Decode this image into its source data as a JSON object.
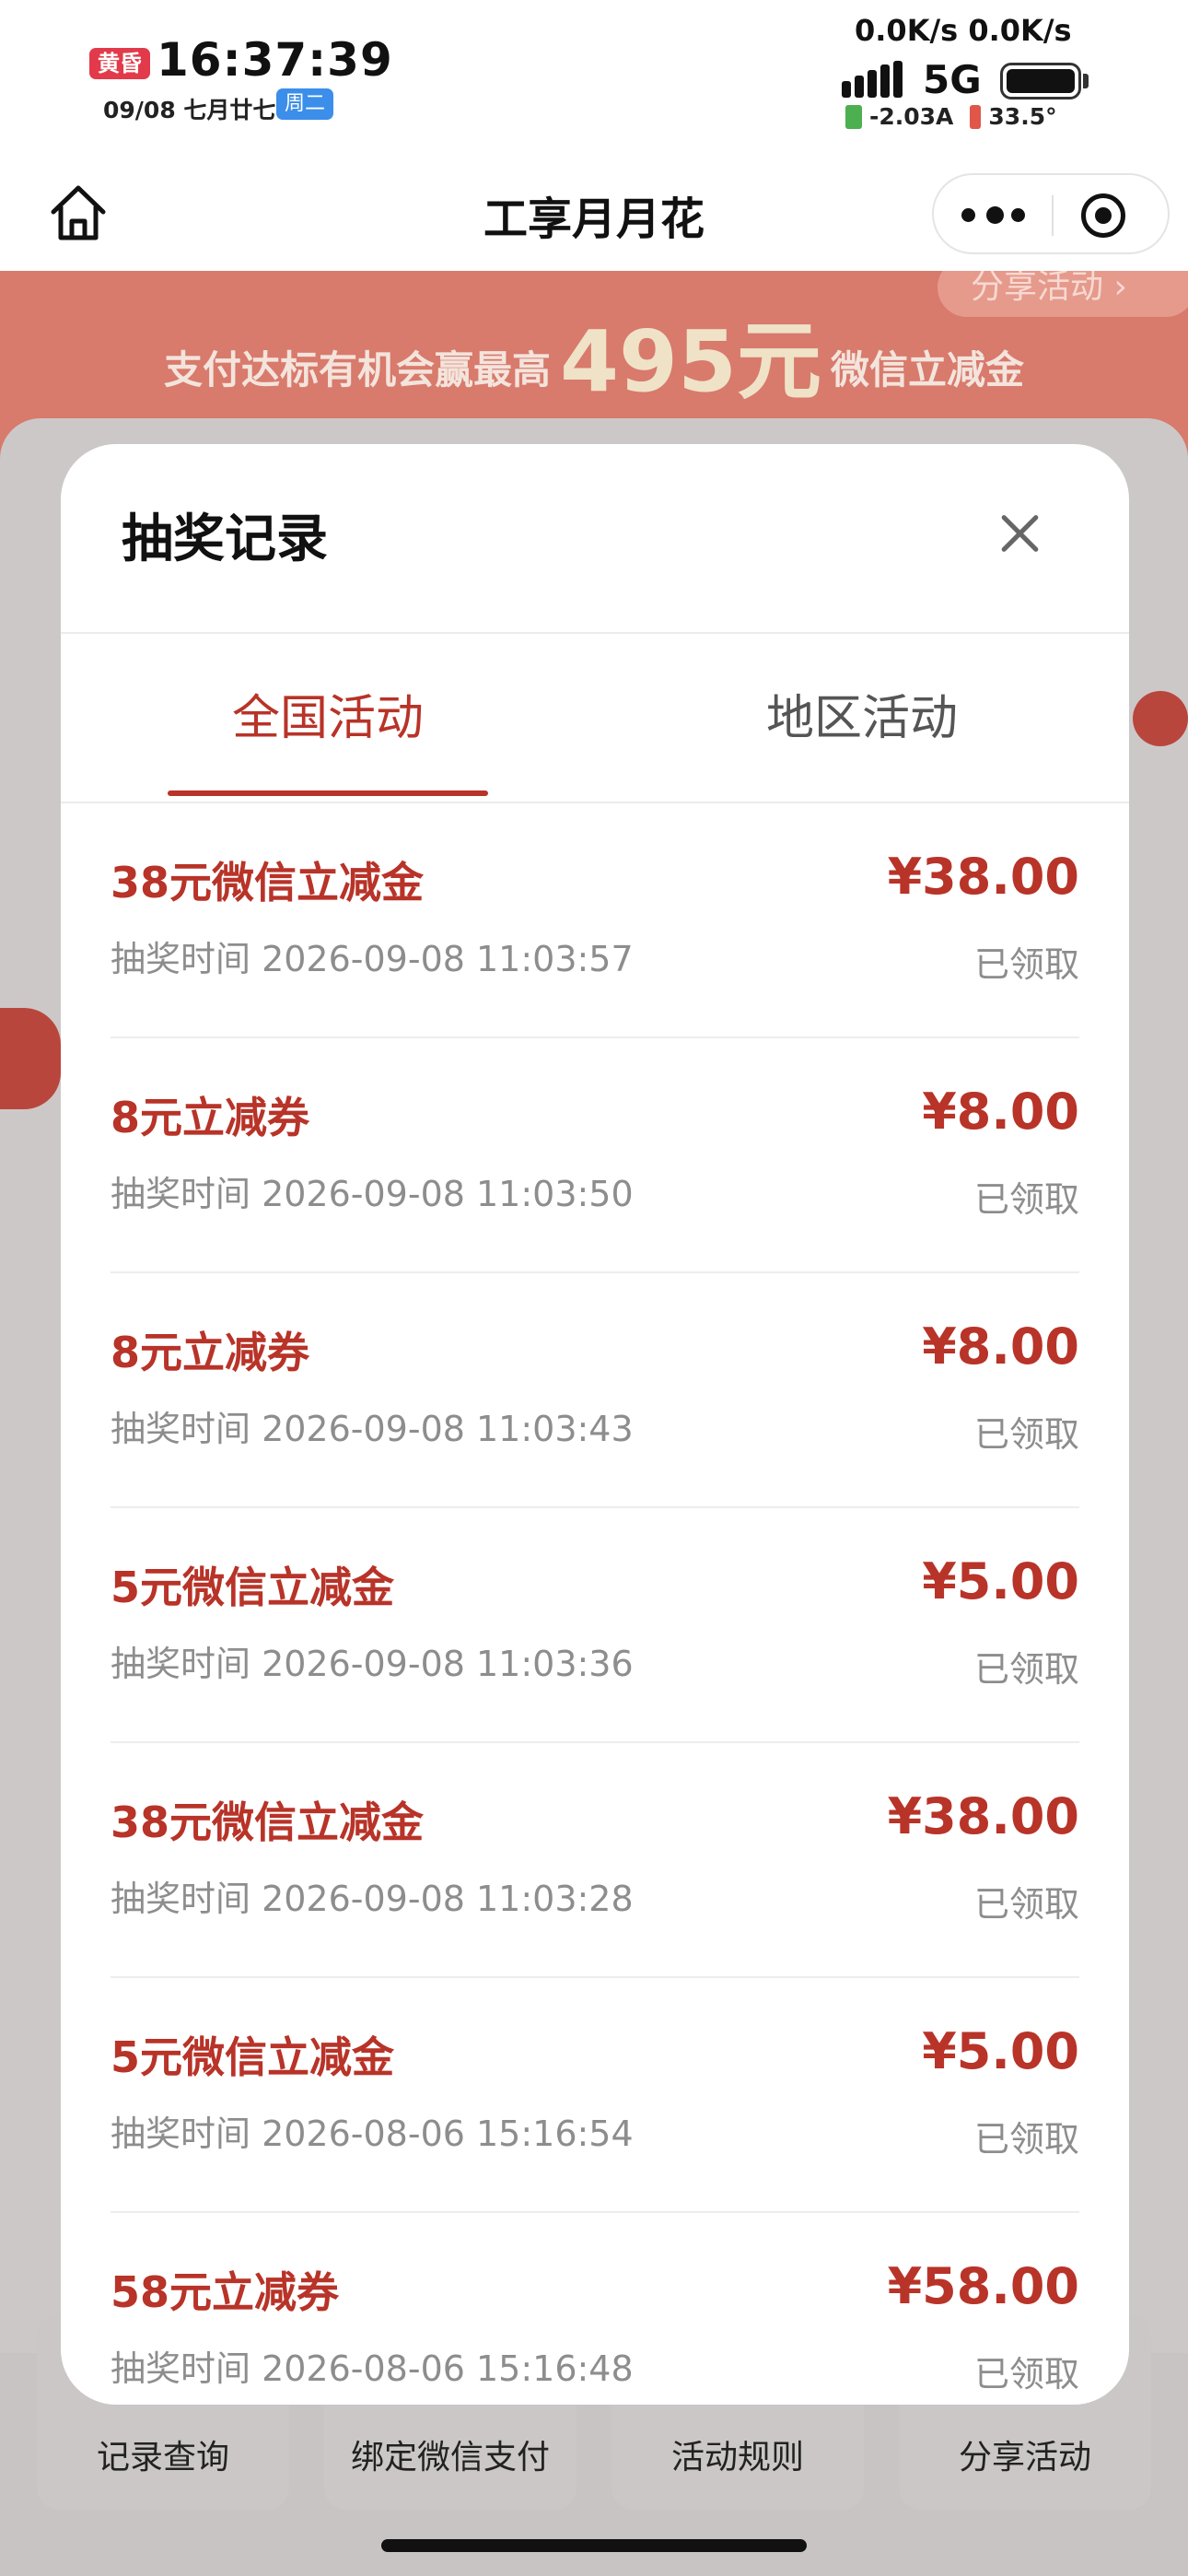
{
  "status_bar": {
    "dusk_label": "黄昏",
    "time": "16:37:39",
    "date": "09/08 七月廿七",
    "weekday": "周二",
    "net_speed": "0.0K/s 0.0K/s",
    "carrier": "5G",
    "current": "-2.03A",
    "temperature": "33.5°"
  },
  "nav": {
    "title": "工享月月花"
  },
  "background": {
    "share_label": "分享活动 ›",
    "banner_prefix": "支付达标有机会赢最高",
    "banner_amount": "495元",
    "banner_suffix": "微信立减金",
    "bottom_buttons": [
      "记录查询",
      "绑定微信支付",
      "活动规则",
      "分享活动"
    ]
  },
  "modal": {
    "title": "抽奖记录",
    "tabs": [
      {
        "label": "全国活动",
        "active": true
      },
      {
        "label": "地区活动",
        "active": false
      }
    ],
    "time_prefix": "抽奖时间",
    "records": [
      {
        "name": "38元微信立减金",
        "time": "抽奖时间 2026-09-08 11:03:57",
        "amount": "¥38.00",
        "status": "已领取"
      },
      {
        "name": "8元立减券",
        "time": "抽奖时间 2026-09-08 11:03:50",
        "amount": "¥8.00",
        "status": "已领取"
      },
      {
        "name": "8元立减券",
        "time": "抽奖时间 2026-09-08 11:03:43",
        "amount": "¥8.00",
        "status": "已领取"
      },
      {
        "name": "5元微信立减金",
        "time": "抽奖时间 2026-09-08 11:03:36",
        "amount": "¥5.00",
        "status": "已领取"
      },
      {
        "name": "38元微信立减金",
        "time": "抽奖时间 2026-09-08 11:03:28",
        "amount": "¥38.00",
        "status": "已领取"
      },
      {
        "name": "5元微信立减金",
        "time": "抽奖时间 2026-08-06 15:16:54",
        "amount": "¥5.00",
        "status": "已领取"
      },
      {
        "name": "58元立减券",
        "time": "抽奖时间 2026-08-06 15:16:48",
        "amount": "¥58.00",
        "status": "已领取"
      }
    ]
  },
  "colors": {
    "accent": "#b83328",
    "muted_text": "#8d8d8d"
  }
}
